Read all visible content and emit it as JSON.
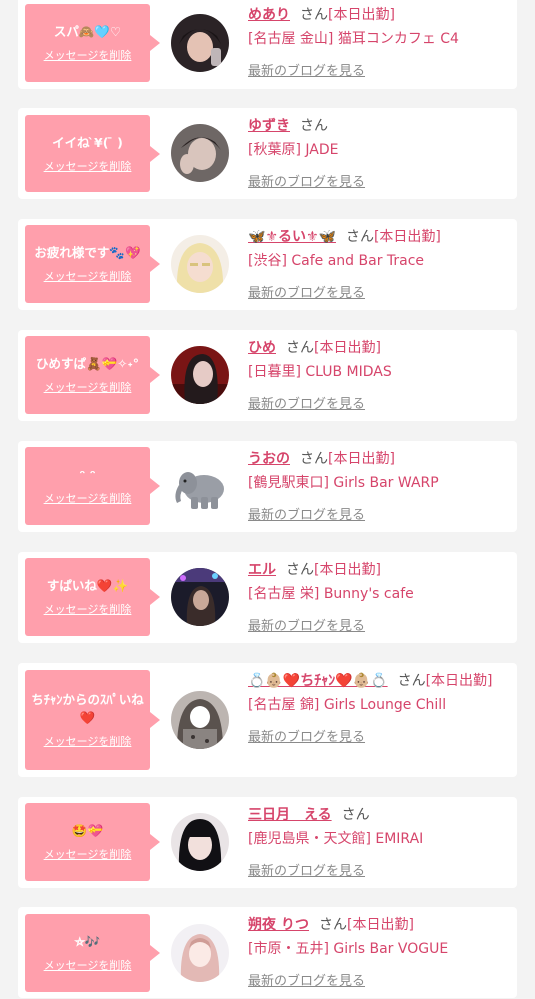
{
  "ui": {
    "delete_label": "メッセージを削除",
    "blog_label": "最新のブログを見る",
    "honorific": "さん"
  },
  "colors": {
    "bubble": "#ff9fac",
    "name": "#d6456b",
    "link_gray": "#8a8a8a"
  },
  "items": [
    {
      "message": "スパ🙈🩵♡",
      "name": "めあり",
      "status": "[本日出勤]",
      "shop": "[名古屋 金山] 猫耳コンカフェ C4",
      "avatar_icon": "girl-photo-avatar"
    },
    {
      "message": "イイね ̀¥( ̄ )",
      "name": "ゆずき",
      "status": "",
      "shop": "[秋葉原] JADE",
      "avatar_icon": "girl-photo-avatar"
    },
    {
      "message": "お疲れ様です🐾💖",
      "name": "🦋⚜るい⚜🦋",
      "status": "[本日出勤]",
      "shop": "[渋谷] Cafe and Bar Trace",
      "avatar_icon": "girl-photo-avatar"
    },
    {
      "message": "ひめすぱ🧸💝✧˖°",
      "name": "ひめ",
      "status": "[本日出勤]",
      "shop": "[日暮里] CLUB MIDAS",
      "avatar_icon": "girl-photo-avatar"
    },
    {
      "message": "ᵔ ᵔ",
      "name": "うおの",
      "status": "[本日出勤]",
      "shop": "[鶴見駅東口] Girls Bar WARP",
      "avatar_icon": "elephant-avatar"
    },
    {
      "message": "すぱいね❤️✨",
      "name": "エル",
      "status": "[本日出勤]",
      "shop": "[名古屋 栄] Bunny's cafe",
      "avatar_icon": "girl-photo-avatar"
    },
    {
      "message": "ちﾁｬﾝからのｽﾊﾟいね❤️",
      "name": "💍👶🏼❤️ちﾁｬﾝ❤️👶🏼💍",
      "status": "[本日出勤]",
      "shop": "[名古屋 錦] Girls Lounge Chill",
      "avatar_icon": "girl-photo-avatar"
    },
    {
      "message": "🤩💝",
      "name": "三日月　える",
      "status": "",
      "shop": "[鹿児島県・天文館] EMIRAI",
      "avatar_icon": "girl-photo-avatar"
    },
    {
      "message": "⛤🎶",
      "name": "朔夜 りつ",
      "status": "[本日出勤]",
      "shop": "[市原・五井] Girls Bar VOGUE",
      "avatar_icon": "girl-photo-avatar"
    }
  ]
}
